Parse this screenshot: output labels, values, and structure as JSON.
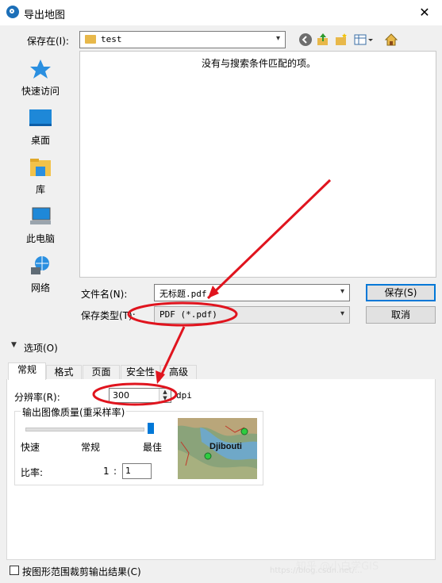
{
  "window": {
    "title": "导出地图",
    "close_glyph": "✕"
  },
  "save_in": {
    "label": "保存在(I):",
    "value": "test"
  },
  "places": [
    {
      "label": "快速访问",
      "icon": "quick-access-star-icon"
    },
    {
      "label": "桌面",
      "icon": "desktop-icon"
    },
    {
      "label": "库",
      "icon": "library-icon"
    },
    {
      "label": "此电脑",
      "icon": "this-pc-icon"
    },
    {
      "label": "网络",
      "icon": "network-icon"
    }
  ],
  "file_list": {
    "empty_message": "没有与搜索条件匹配的项。"
  },
  "file_name": {
    "label": "文件名(N):",
    "value": "无标题.pdf"
  },
  "save_type": {
    "label": "保存类型(T):",
    "value": "PDF (*.pdf)"
  },
  "buttons": {
    "save": "保存(S)",
    "cancel": "取消"
  },
  "options": {
    "label": "选项(O)"
  },
  "tabs": [
    "常规",
    "格式",
    "页面",
    "安全性",
    "高级"
  ],
  "resolution": {
    "label": "分辨率(R):",
    "value": "300",
    "unit": "dpi"
  },
  "quality": {
    "group_title": "输出图像质量(重采样率)",
    "ticks": [
      "快速",
      "常规",
      "最佳"
    ],
    "level": 1.0,
    "ratio_label": "比率:",
    "ratio_left": "1",
    "ratio_sep": ":",
    "ratio_value": "1"
  },
  "preview": {
    "map_label": "Djibouti"
  },
  "clip": {
    "label": "按图形范围裁剪输出结果(C)",
    "checked": false
  },
  "watermark": {
    "text": "知乎 @小白学GIS",
    "url": "https://blog.csdn.net/..."
  },
  "colors": {
    "accent": "#0078d7",
    "annotation_red": "#e0141e"
  }
}
